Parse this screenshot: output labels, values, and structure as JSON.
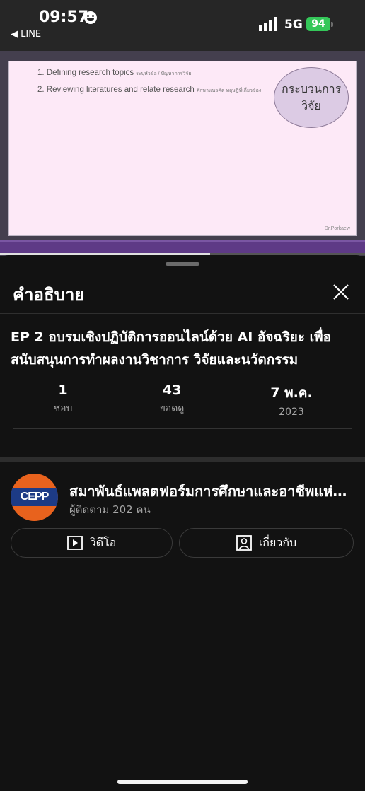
{
  "status_bar": {
    "time": "09:57",
    "back_app": "◀ LINE",
    "network": "5G",
    "battery": "94"
  },
  "video": {
    "slide": {
      "line1": "1. Defining research topics",
      "line1_note": "ระบุหัวข้อ / ปัญหาการวิจัย",
      "line2": "2. Reviewing literatures and relate research",
      "line2_note": "ศึกษาแนวคิด ทฤษฎีที่เกี่ยวข้อง",
      "oval_text": "กระบวนการวิจัย",
      "credit": "Dr.Porkaew"
    },
    "progress": 0.575
  },
  "sheet": {
    "title": "คำอธิบาย",
    "video_title": "EP 2 อบรมเชิงปฏิบัติการออนไลน์ด้วย AI อัจฉริยะ เพื่อสนับสนุนการทำผลงานวิชาการ วิจัยและนวัตกรรม",
    "stats": [
      {
        "value": "1",
        "label": "ชอบ"
      },
      {
        "value": "43",
        "label": "ยอดดู"
      },
      {
        "value": "7 พ.ค.",
        "label": "2023"
      }
    ],
    "channel": {
      "avatar_text": "CEPP",
      "name": "สมาพันธ์แพลตฟอร์มการศึกษาและอาชีพแห่งประเทศไทย",
      "subscribers": "ผู้ติดตาม 202 คน"
    },
    "buttons": {
      "videos": "วิดีโอ",
      "about": "เกี่ยวกับ"
    }
  },
  "colors": {
    "background": "#121212",
    "battery": "#34c759",
    "slide_bg": "#fde9f7",
    "band": "#5e3a86"
  }
}
